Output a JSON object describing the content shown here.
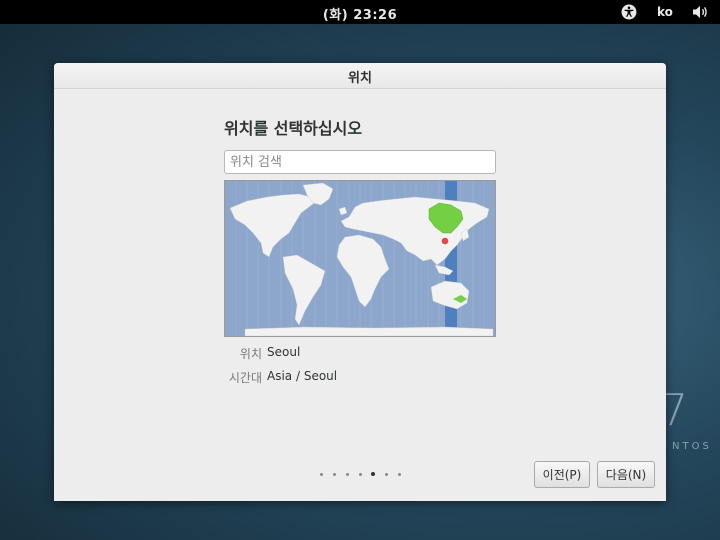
{
  "topbar": {
    "clock": "(화) 23:26",
    "language": "ko",
    "accessibility_icon": "accessibility-icon",
    "volume_icon": "volume-icon"
  },
  "desktop": {
    "brand_number": "7",
    "brand_text": "NTOS"
  },
  "dialog": {
    "title": "위치",
    "heading": "위치를 선택하십시오",
    "search": {
      "placeholder": "위치 검색",
      "value": ""
    },
    "info": {
      "location_label": "위치",
      "location_value": "Seoul",
      "timezone_label": "시간대",
      "timezone_value": "Asia / Seoul"
    },
    "pager": {
      "total": 7,
      "current": 5
    },
    "buttons": {
      "prev": "이전(P)",
      "next": "다음(N)"
    }
  },
  "colors": {
    "ocean": "#8da6cc",
    "land": "#f2f2f2",
    "timezone_band": "#4f7fbf",
    "highlight_region": "#73d044",
    "marker": "#e24a4a"
  }
}
